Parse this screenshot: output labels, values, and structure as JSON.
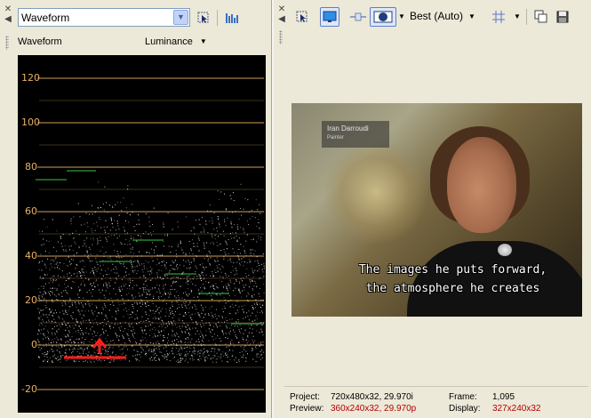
{
  "scopes_panel": {
    "scope_type_value": "Waveform",
    "scope_title": "Waveform",
    "mode_dropdown_value": "Luminance",
    "y_axis_ticks": [
      "120",
      "100",
      "80",
      "60",
      "40",
      "20",
      "0",
      "-20"
    ]
  },
  "preview_panel": {
    "quality_value": "Best (Auto)",
    "video": {
      "lower_third_name": "Iran Darroudi",
      "lower_third_role": "Painter",
      "subtitle_line1": "The images he puts forward,",
      "subtitle_line2": "the atmosphere he creates"
    },
    "status": {
      "project_label": "Project:",
      "project_value": "720x480x32, 29.970i",
      "frame_label": "Frame:",
      "frame_value": "1,095",
      "preview_label": "Preview:",
      "preview_value": "360x240x32, 29.970p",
      "display_label": "Display:",
      "display_value": "327x240x32"
    }
  },
  "colors": {
    "graticule": "#e8b063",
    "annotation": "#ff1e1e",
    "status_highlight": "#b00000"
  },
  "icons": [
    "close-icon",
    "collapse-arrow-icon",
    "dropdown-arrow-icon",
    "pointer-icon",
    "histogram-icon",
    "monitor-icon",
    "split-screen-icon",
    "overlay-icon",
    "grid-icon",
    "copy-snapshot-icon",
    "save-snapshot-icon",
    "annotation-arrow-icon"
  ]
}
